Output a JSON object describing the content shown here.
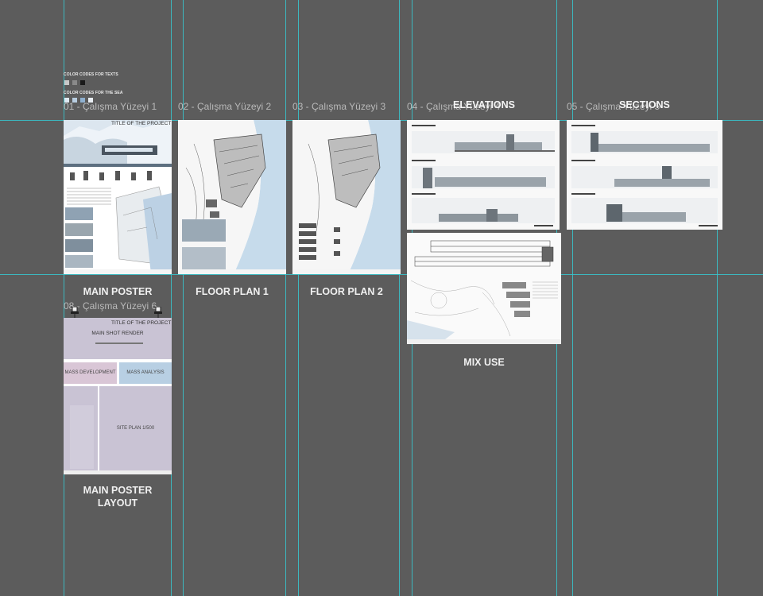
{
  "artboards": [
    {
      "title": "01 - Çalışma Yüzeyi 1",
      "label": "MAIN POSTER"
    },
    {
      "title": "02 - Çalışma Yüzeyi 2",
      "label": "FLOOR PLAN 1"
    },
    {
      "title": "03 - Çalışma Yüzeyi 3",
      "label": "FLOOR PLAN 2"
    },
    {
      "title": "04 - Çalışma Yüzeyi 4",
      "overlay": "ELEVATIONS",
      "label": "MIX USE"
    },
    {
      "title": "05 - Çalışma Yüzeyi 5",
      "overlay": "SECTIONS"
    },
    {
      "title": "08 - Çalışma Yüzeyi 6",
      "label": "MAIN POSTER LAYOUT"
    }
  ],
  "color_codes": {
    "texts_label": "COLOR CODES FOR TEXTS",
    "sea_label": "COLOR CODES FOR THE SEA",
    "text_swatches": [
      "#c8c8c8",
      "#8a8a8a",
      "#1a1a1a"
    ],
    "sea_swatches": [
      "#dfe9f2",
      "#b8cde0",
      "#8fb0cf",
      "#e9eef3"
    ]
  },
  "main_poster": {
    "title": "TITLE OF THE PROJECT"
  },
  "layout_poster": {
    "title": "TITLE OF THE PROJECT",
    "main_shot": "MAIN SHOT RENDER",
    "mass_development": "MASS DEVELOPMENT",
    "mass_analysis": "MASS ANALYSIS",
    "site_plan": "SITE PLAN 1/500"
  },
  "colors": {
    "canvas": "#5c5c5c",
    "guide": "#36c8d0",
    "layout_purple": "#c8bfd3",
    "layout_blue": "#b8cfe3",
    "layout_mauve": "#d9c6d6"
  }
}
